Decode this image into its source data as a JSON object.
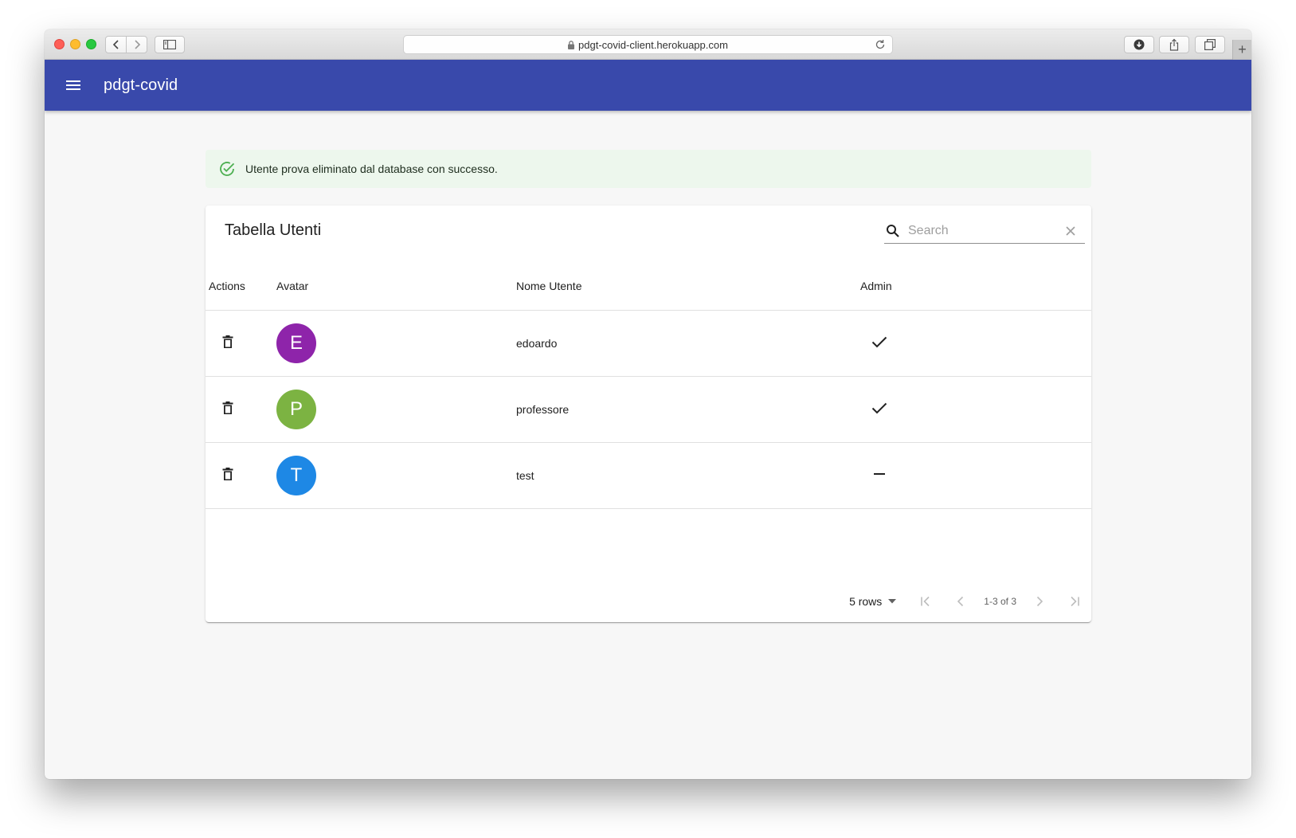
{
  "browser": {
    "url": "pdgt-covid-client.herokuapp.com",
    "new_tab_label": "+"
  },
  "appbar": {
    "title": "pdgt-covid",
    "color": "#3949ab"
  },
  "alert": {
    "message": "Utente prova eliminato dal database con successo.",
    "severity": "success",
    "icon": "check-circle-outline-icon"
  },
  "table": {
    "title": "Tabella Utenti",
    "search_placeholder": "Search",
    "columns": [
      "Actions",
      "Avatar",
      "Nome Utente",
      "Admin"
    ],
    "rows": [
      {
        "initial": "E",
        "avatar_color": "#8e24aa",
        "username": "edoardo",
        "admin": true
      },
      {
        "initial": "P",
        "avatar_color": "#7cb342",
        "username": "professore",
        "admin": true
      },
      {
        "initial": "T",
        "avatar_color": "#1e88e5",
        "username": "test",
        "admin": false
      }
    ],
    "pagination": {
      "rows_per_page": "5 rows",
      "range": "1-3 of 3"
    }
  }
}
